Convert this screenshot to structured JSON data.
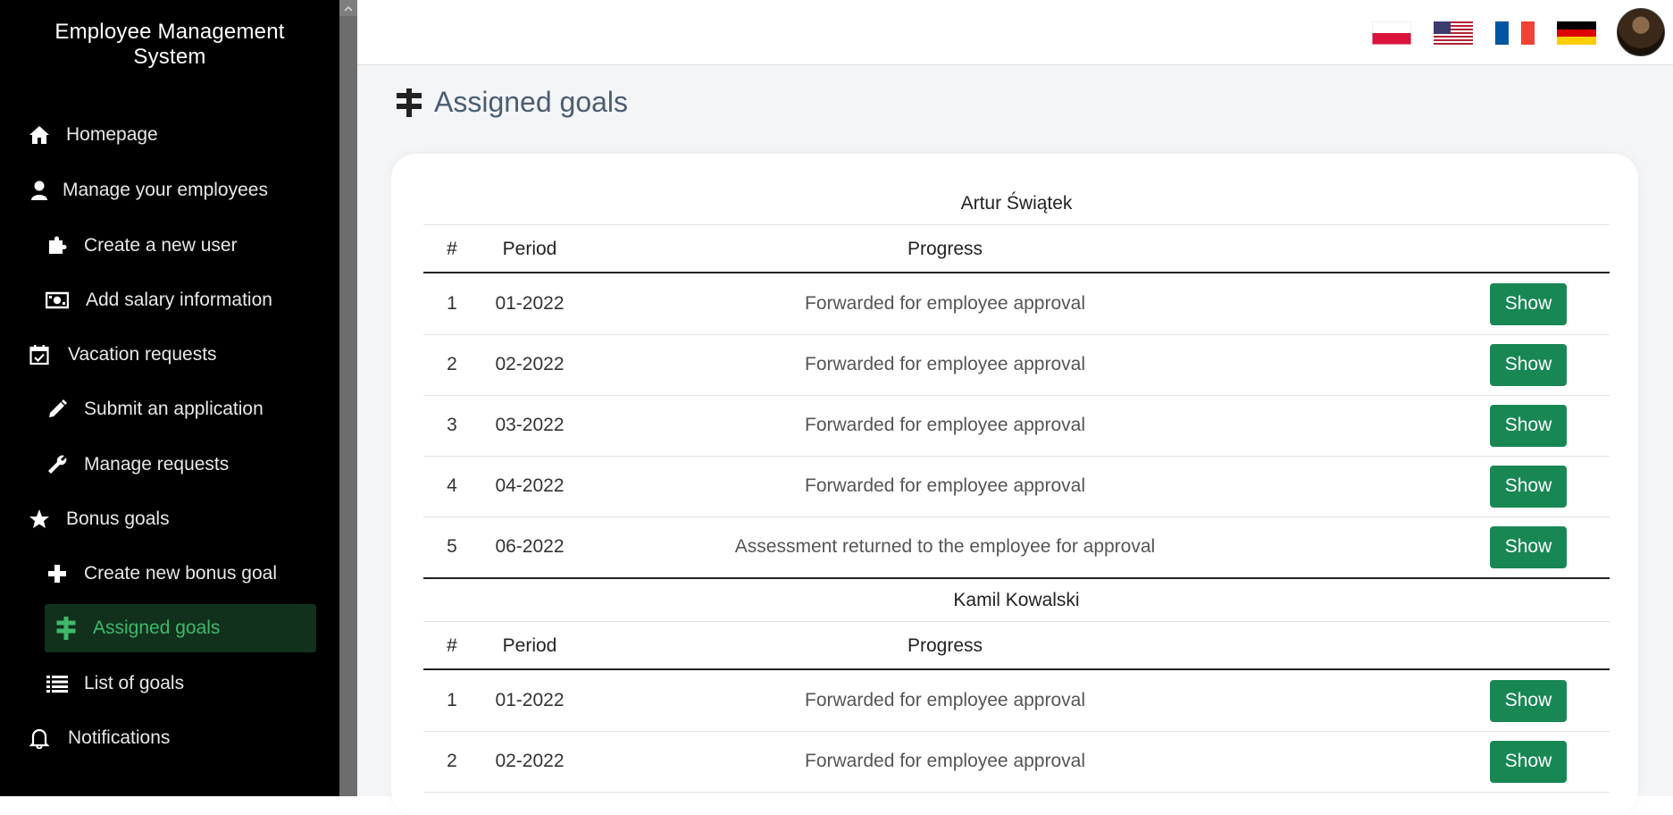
{
  "app": {
    "title_line1": "Employee Management",
    "title_line2": "System"
  },
  "sidebar": {
    "items": [
      {
        "label": "Homepage",
        "icon": "home-icon"
      },
      {
        "label": "Manage your employees",
        "icon": "user-icon"
      },
      {
        "label": "Create a new user",
        "icon": "puzzle-icon"
      },
      {
        "label": "Add salary information",
        "icon": "money-bill-icon"
      },
      {
        "label": "Vacation requests",
        "icon": "calendar-check-icon"
      },
      {
        "label": "Submit an application",
        "icon": "pencil-icon"
      },
      {
        "label": "Manage requests",
        "icon": "wrench-icon"
      },
      {
        "label": "Bonus goals",
        "icon": "star-icon"
      },
      {
        "label": "Create new bonus goal",
        "icon": "plus-icon"
      },
      {
        "label": "Assigned goals",
        "icon": "signpost-icon",
        "active": true
      },
      {
        "label": "List of goals",
        "icon": "list-icon"
      },
      {
        "label": "Notifications",
        "icon": "bell-icon"
      }
    ]
  },
  "topbar": {
    "languages": [
      "pl-flag-icon",
      "us-flag-icon",
      "fr-flag-icon",
      "de-flag-icon"
    ],
    "avatar": "user-avatar"
  },
  "page": {
    "title": "Assigned goals"
  },
  "table": {
    "headers": {
      "num": "#",
      "period": "Period",
      "progress": "Progress"
    },
    "button_label": "Show",
    "groups": [
      {
        "employee": "Artur Świątek",
        "rows": [
          {
            "num": "1",
            "period": "01-2022",
            "progress": "Forwarded for employee approval"
          },
          {
            "num": "2",
            "period": "02-2022",
            "progress": "Forwarded for employee approval"
          },
          {
            "num": "3",
            "period": "03-2022",
            "progress": "Forwarded for employee approval"
          },
          {
            "num": "4",
            "period": "04-2022",
            "progress": "Forwarded for employee approval"
          },
          {
            "num": "5",
            "period": "06-2022",
            "progress": "Assessment returned to the employee for approval"
          }
        ]
      },
      {
        "employee": "Kamil Kowalski",
        "rows": [
          {
            "num": "1",
            "period": "01-2022",
            "progress": "Forwarded for employee approval"
          },
          {
            "num": "2",
            "period": "02-2022",
            "progress": "Forwarded for employee approval"
          }
        ]
      }
    ]
  },
  "colors": {
    "sidebar_bg": "#000000",
    "active_bg": "#11311c",
    "active_text": "#3fb96c",
    "button": "#198754",
    "title": "#4a5d72"
  }
}
